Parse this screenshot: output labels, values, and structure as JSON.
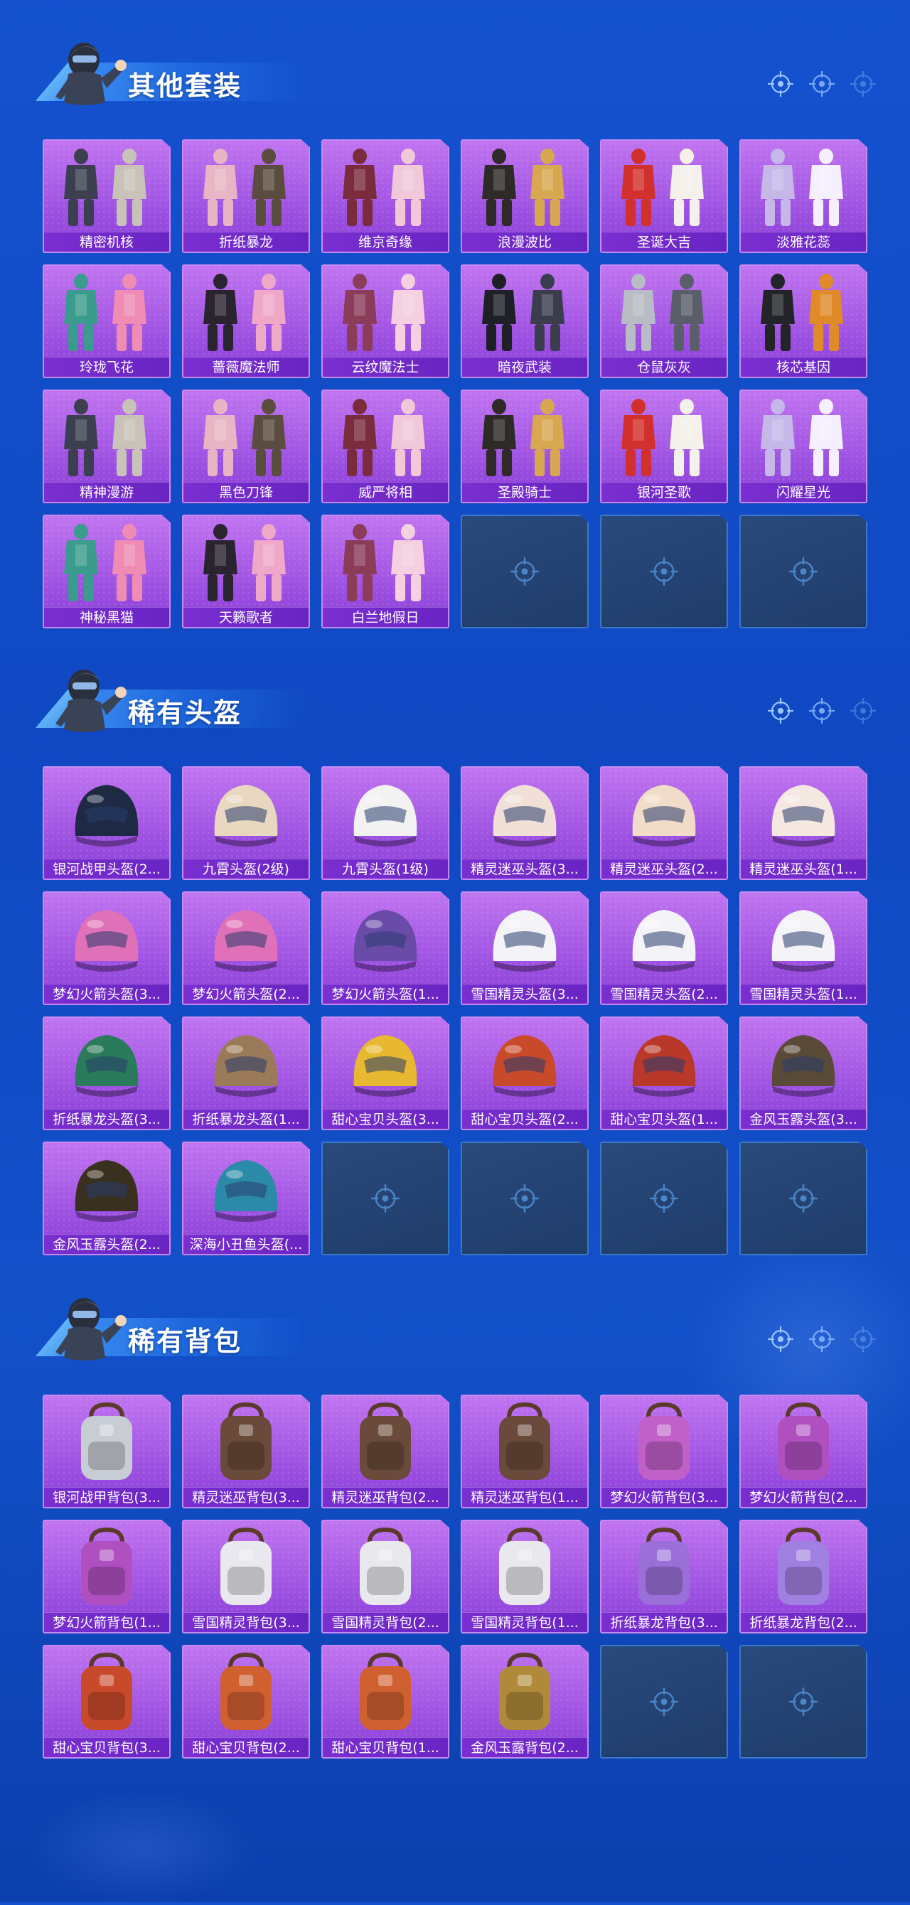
{
  "colors": {
    "background": "#1552cf",
    "tile_purple": "#a85ae8",
    "label_band": "#7a2fd0",
    "empty_tile": "#24467a",
    "title_text": "#ffffff"
  },
  "sections": [
    {
      "title": "其他套装",
      "items": [
        {
          "label": "精密机核",
          "art": "outfit"
        },
        {
          "label": "折纸暴龙",
          "art": "outfit"
        },
        {
          "label": "维京奇缘",
          "art": "outfit"
        },
        {
          "label": "浪漫波比",
          "art": "outfit"
        },
        {
          "label": "圣诞大吉",
          "art": "outfit"
        },
        {
          "label": "淡雅花蕊",
          "art": "outfit"
        },
        {
          "label": "玲珑飞花",
          "art": "outfit"
        },
        {
          "label": "蔷薇魔法师",
          "art": "outfit"
        },
        {
          "label": "云纹魔法士",
          "art": "outfit"
        },
        {
          "label": "暗夜武装",
          "art": "outfit"
        },
        {
          "label": "仓鼠灰灰",
          "art": "outfit"
        },
        {
          "label": "核芯基因",
          "art": "outfit"
        },
        {
          "label": "精神漫游",
          "art": "outfit"
        },
        {
          "label": "黑色刀锋",
          "art": "outfit"
        },
        {
          "label": "威严将相",
          "art": "outfit"
        },
        {
          "label": "圣殿骑士",
          "art": "outfit"
        },
        {
          "label": "银河圣歌",
          "art": "outfit"
        },
        {
          "label": "闪耀星光",
          "art": "outfit"
        },
        {
          "label": "神秘黑猫",
          "art": "outfit"
        },
        {
          "label": "天籁歌者",
          "art": "outfit"
        },
        {
          "label": "白兰地假日",
          "art": "outfit"
        }
      ],
      "empty_slots": 3
    },
    {
      "title": "稀有头盔",
      "items": [
        {
          "label": "银河战甲头盔(2...",
          "art": "helmet"
        },
        {
          "label": "九霄头盔(2级)",
          "art": "helmet"
        },
        {
          "label": "九霄头盔(1级)",
          "art": "helmet"
        },
        {
          "label": "精灵迷巫头盔(3...",
          "art": "helmet"
        },
        {
          "label": "精灵迷巫头盔(2...",
          "art": "helmet"
        },
        {
          "label": "精灵迷巫头盔(1...",
          "art": "helmet"
        },
        {
          "label": "梦幻火箭头盔(3...",
          "art": "helmet"
        },
        {
          "label": "梦幻火箭头盔(2...",
          "art": "helmet"
        },
        {
          "label": "梦幻火箭头盔(1...",
          "art": "helmet"
        },
        {
          "label": "雪国精灵头盔(3...",
          "art": "helmet"
        },
        {
          "label": "雪国精灵头盔(2...",
          "art": "helmet"
        },
        {
          "label": "雪国精灵头盔(1...",
          "art": "helmet"
        },
        {
          "label": "折纸暴龙头盔(3...",
          "art": "helmet"
        },
        {
          "label": "折纸暴龙头盔(1...",
          "art": "helmet"
        },
        {
          "label": "甜心宝贝头盔(3...",
          "art": "helmet"
        },
        {
          "label": "甜心宝贝头盔(2...",
          "art": "helmet"
        },
        {
          "label": "甜心宝贝头盔(1...",
          "art": "helmet"
        },
        {
          "label": "金风玉露头盔(3...",
          "art": "helmet"
        },
        {
          "label": "金风玉露头盔(2...",
          "art": "helmet"
        },
        {
          "label": "深海小丑鱼头盔(...",
          "art": "helmet"
        }
      ],
      "empty_slots": 4
    },
    {
      "title": "稀有背包",
      "items": [
        {
          "label": "银河战甲背包(3...",
          "art": "backpack"
        },
        {
          "label": "精灵迷巫背包(3...",
          "art": "backpack"
        },
        {
          "label": "精灵迷巫背包(2...",
          "art": "backpack"
        },
        {
          "label": "精灵迷巫背包(1...",
          "art": "backpack"
        },
        {
          "label": "梦幻火箭背包(3...",
          "art": "backpack"
        },
        {
          "label": "梦幻火箭背包(2...",
          "art": "backpack"
        },
        {
          "label": "梦幻火箭背包(1...",
          "art": "backpack"
        },
        {
          "label": "雪国精灵背包(3...",
          "art": "backpack"
        },
        {
          "label": "雪国精灵背包(2...",
          "art": "backpack"
        },
        {
          "label": "雪国精灵背包(1...",
          "art": "backpack"
        },
        {
          "label": "折纸暴龙背包(3...",
          "art": "backpack"
        },
        {
          "label": "折纸暴龙背包(2...",
          "art": "backpack"
        },
        {
          "label": "甜心宝贝背包(3...",
          "art": "backpack"
        },
        {
          "label": "甜心宝贝背包(2...",
          "art": "backpack"
        },
        {
          "label": "甜心宝贝背包(1...",
          "art": "backpack"
        },
        {
          "label": "金风玉露背包(2...",
          "art": "backpack"
        }
      ],
      "empty_slots": 2
    }
  ]
}
